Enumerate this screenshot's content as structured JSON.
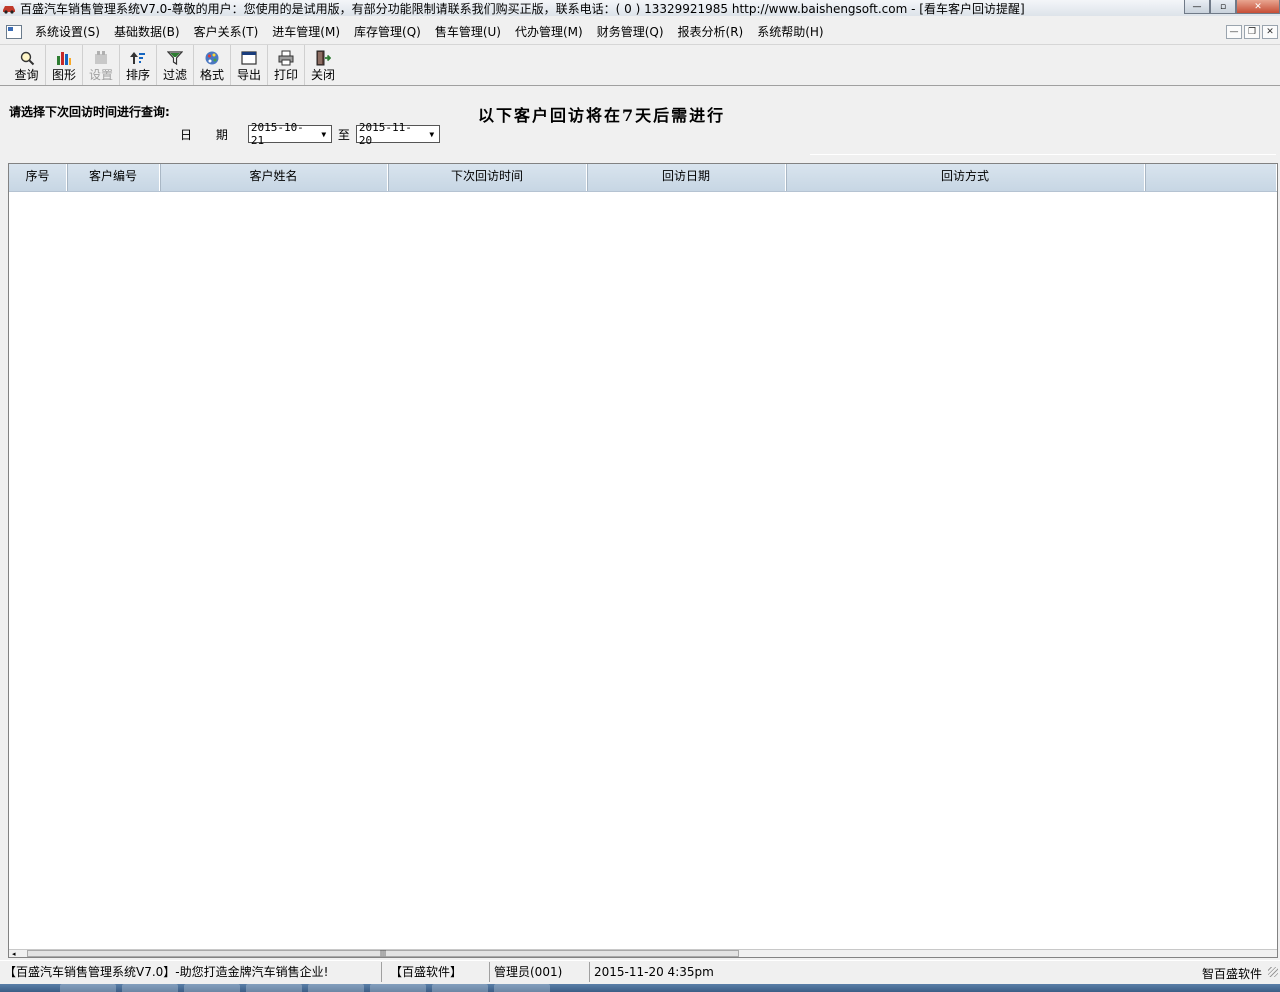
{
  "window": {
    "title": "百盛汽车销售管理系统V7.0-尊敬的用户：您使用的是试用版，有部分功能限制请联系我们购买正版，联系电话：( 0 ) 13329921985  http://www.baishengsoft.com - [看车客户回访提醒]",
    "controls": {
      "minimize": "—",
      "maximize": "▫",
      "close": "✕"
    }
  },
  "menu": {
    "items": [
      "系统设置(S)",
      "基础数据(B)",
      "客户关系(T)",
      "进车管理(M)",
      "库存管理(Q)",
      "售车管理(U)",
      "代办管理(M)",
      "财务管理(Q)",
      "报表分析(R)",
      "系统帮助(H)"
    ],
    "mdi_controls": {
      "minimize": "—",
      "restore": "❐",
      "close": "✕"
    }
  },
  "toolbar": {
    "buttons": [
      {
        "label": "查询",
        "icon": "search-icon",
        "enabled": true
      },
      {
        "label": "图形",
        "icon": "chart-icon",
        "enabled": true
      },
      {
        "label": "设置",
        "icon": "settings-icon",
        "enabled": false
      },
      {
        "label": "排序",
        "icon": "sort-icon",
        "enabled": true
      },
      {
        "label": "过滤",
        "icon": "filter-icon",
        "enabled": true
      },
      {
        "label": "格式",
        "icon": "format-icon",
        "enabled": true
      },
      {
        "label": "导出",
        "icon": "export-icon",
        "enabled": true
      },
      {
        "label": "打印",
        "icon": "print-icon",
        "enabled": true
      },
      {
        "label": "关闭",
        "icon": "exit-icon",
        "enabled": true
      }
    ]
  },
  "query": {
    "prompt": "请选择下次回访时间进行查询:",
    "date_label": "日 期",
    "from_date": "2015-10-21",
    "separator": "至",
    "to_date": "2015-11-20",
    "notice": "以下客户回访将在7天后需进行"
  },
  "grid": {
    "columns": [
      "序号",
      "客户编号",
      "客户姓名",
      "下次回访时间",
      "回访日期",
      "回访方式"
    ],
    "rows": []
  },
  "statusbar": {
    "app_slogan": "【百盛汽车销售管理系统V7.0】-助您打造金牌汽车销售企业!",
    "company": "【百盛软件】",
    "user": "管理员(001)",
    "datetime": "2015-11-20 4:35pm",
    "brand": "智百盛软件"
  }
}
